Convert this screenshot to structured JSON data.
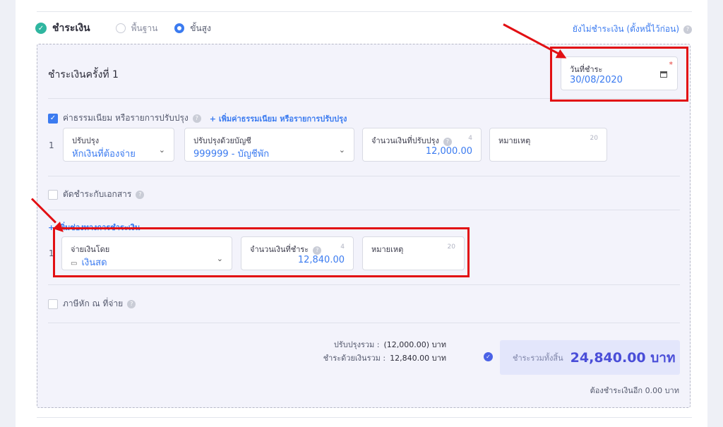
{
  "header": {
    "title": "ชำระเงิน",
    "mode_basic": "พื้นฐาน",
    "mode_advanced": "ขั้นสูง",
    "unpaid_link": "ยังไม่ชำระเงิน (ตั้งหนี้ไว้ก่อน)"
  },
  "payment": {
    "title": "ชำระเงินครั้งที่ 1",
    "date_label": "วันที่ชำระ",
    "date_value": "30/08/2020"
  },
  "fee": {
    "checkbox_label": "ค่าธรรมเนียม หรือรายการปรับปรุง",
    "add_link": "+ เพิ่มค่าธรรมเนียม หรือรายการปรับปรุง",
    "row_no": "1",
    "adjust_label": "ปรับปรุง",
    "adjust_value": "หักเงินที่ต้องจ่าย",
    "account_label": "ปรับปรุงด้วยบัญชี",
    "account_value": "999999 - บัญชีพัก",
    "amount_label": "จำนวนเงินที่ปรับปรุง",
    "amount_count": "4",
    "amount_value": "12,000.00",
    "note_label": "หมายเหตุ",
    "note_count": "20"
  },
  "doc_offset": {
    "label": "ตัดชำระกับเอกสาร"
  },
  "channel": {
    "add_link": "+ เพิ่มช่องทางการชำระเงิน",
    "row_no": "1",
    "pay_by_label": "จ่ายเงินโดย",
    "pay_by_value": "เงินสด",
    "amount_label": "จำนวนเงินที่ชำระ",
    "amount_count": "4",
    "amount_value": "12,840.00",
    "note_label": "หมายเหตุ",
    "note_count": "20"
  },
  "withholding": {
    "label": "ภาษีหัก ณ ที่จ่าย"
  },
  "summary": {
    "adjust_total_label": "ปรับปรุงรวม :",
    "adjust_total_value": "(12,000.00) บาท",
    "paid_total_label": "ชำระด้วยเงินรวม :",
    "paid_total_value": "12,840.00 บาท",
    "grand_label": "ชำระรวมทั้งสิ้น",
    "grand_value": "24,840.00 บาท",
    "remain": "ต้องชำระเงินอีก 0.00 บาท"
  },
  "colors": {
    "accent": "#3b7bf0",
    "highlight": "#e20f13",
    "success": "#2fb6a0"
  }
}
